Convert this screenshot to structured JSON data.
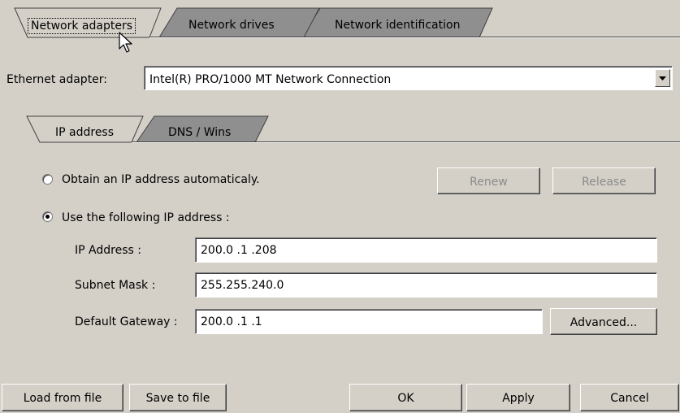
{
  "tabs_top": [
    {
      "label": "Network adapters",
      "active": true
    },
    {
      "label": "Network drives",
      "active": false
    },
    {
      "label": "Network identification",
      "active": false
    }
  ],
  "ethernet": {
    "label": "Ethernet adapter:",
    "value": "Intel(R) PRO/1000 MT Network Connection"
  },
  "tabs_inner": [
    {
      "label": "IP address",
      "active": true
    },
    {
      "label": "DNS / Wins",
      "active": false
    }
  ],
  "ip": {
    "obtain_auto_label": "Obtain an IP address automaticaly.",
    "use_following_label": "Use the following IP address :",
    "selected_option": "use_following",
    "renew_label": "Renew",
    "release_label": "Release",
    "ip_address_label": "IP Address :",
    "ip_address_value": "200.0  .1  .208",
    "subnet_mask_label": "Subnet Mask :",
    "subnet_mask_value": "255.255.240.0",
    "default_gateway_label": "Default Gateway :",
    "default_gateway_value": "200.0  .1  .1",
    "advanced_label": "Advanced..."
  },
  "footer": {
    "load_label": "Load from file",
    "save_label": "Save to file",
    "ok_label": "OK",
    "apply_label": "Apply",
    "cancel_label": "Cancel"
  },
  "colors": {
    "background": "#d4d0c8",
    "inactive_tab": "#8f8f8f",
    "disabled_text": "#8a8a8a"
  }
}
